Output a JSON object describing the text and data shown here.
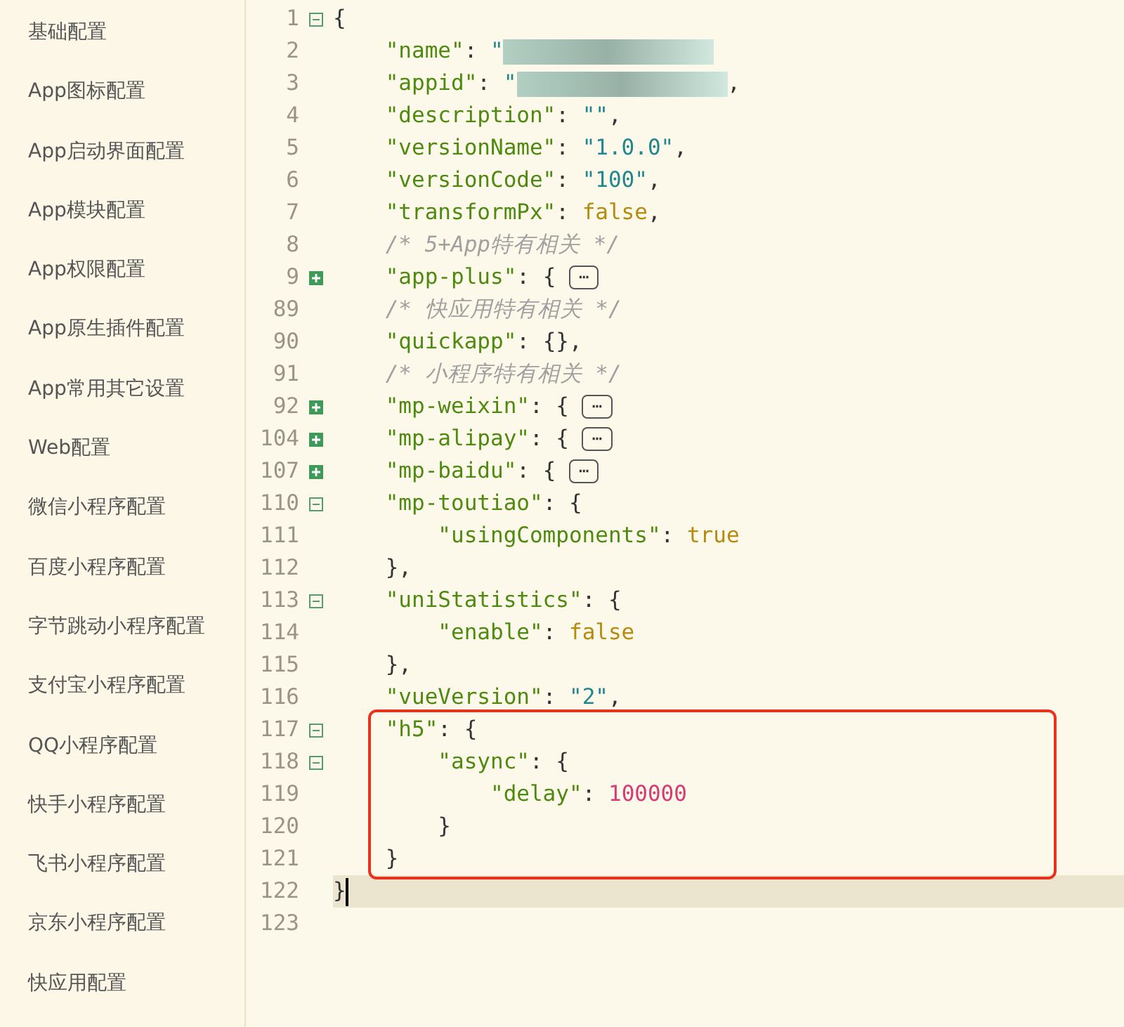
{
  "sidebar": {
    "items": [
      {
        "label": "基础配置"
      },
      {
        "label": "App图标配置"
      },
      {
        "label": "App启动界面配置"
      },
      {
        "label": "App模块配置"
      },
      {
        "label": "App权限配置"
      },
      {
        "label": "App原生插件配置"
      },
      {
        "label": "App常用其它设置"
      },
      {
        "label": "Web配置"
      },
      {
        "label": "微信小程序配置"
      },
      {
        "label": "百度小程序配置"
      },
      {
        "label": "字节跳动小程序配置"
      },
      {
        "label": "支付宝小程序配置"
      },
      {
        "label": "QQ小程序配置"
      },
      {
        "label": "快手小程序配置"
      },
      {
        "label": "飞书小程序配置"
      },
      {
        "label": "京东小程序配置"
      },
      {
        "label": "快应用配置"
      }
    ]
  },
  "editor": {
    "lines": [
      {
        "number": "1",
        "expanded": true,
        "boxed": false,
        "current": false,
        "tokens": [
          {
            "kind": "punct",
            "text": "{"
          }
        ]
      },
      {
        "number": "2",
        "boxed": false,
        "current": false,
        "tokens": [
          {
            "kind": "key",
            "text": "    \"name\""
          },
          {
            "kind": "punct",
            "text": ": "
          },
          {
            "kind": "string",
            "text": "\""
          },
          {
            "kind": "blur"
          }
        ]
      },
      {
        "number": "3",
        "boxed": false,
        "current": false,
        "tokens": [
          {
            "kind": "key",
            "text": "    \"appid\""
          },
          {
            "kind": "punct",
            "text": ": "
          },
          {
            "kind": "string",
            "text": "\""
          },
          {
            "kind": "blur"
          },
          {
            "kind": "punct",
            "text": ","
          }
        ]
      },
      {
        "number": "4",
        "boxed": false,
        "current": false,
        "tokens": [
          {
            "kind": "key",
            "text": "    \"description\""
          },
          {
            "kind": "punct",
            "text": ": "
          },
          {
            "kind": "string",
            "text": "\"\""
          },
          {
            "kind": "punct",
            "text": ","
          }
        ]
      },
      {
        "number": "5",
        "boxed": false,
        "current": false,
        "tokens": [
          {
            "kind": "key",
            "text": "    \"versionName\""
          },
          {
            "kind": "punct",
            "text": ": "
          },
          {
            "kind": "string",
            "text": "\"1.0.0\""
          },
          {
            "kind": "punct",
            "text": ","
          }
        ]
      },
      {
        "number": "6",
        "boxed": false,
        "current": false,
        "tokens": [
          {
            "kind": "key",
            "text": "    \"versionCode\""
          },
          {
            "kind": "punct",
            "text": ": "
          },
          {
            "kind": "string",
            "text": "\"100\""
          },
          {
            "kind": "punct",
            "text": ","
          }
        ]
      },
      {
        "number": "7",
        "boxed": false,
        "current": false,
        "tokens": [
          {
            "kind": "key",
            "text": "    \"transformPx\""
          },
          {
            "kind": "punct",
            "text": ": "
          },
          {
            "kind": "bool",
            "text": "false"
          },
          {
            "kind": "punct",
            "text": ","
          }
        ]
      },
      {
        "number": "8",
        "boxed": false,
        "current": false,
        "tokens": [
          {
            "kind": "comment",
            "text": "    /* 5+App特有相关 */"
          }
        ]
      },
      {
        "number": "9",
        "expanded": false,
        "boxed": false,
        "current": false,
        "tokens": [
          {
            "kind": "key",
            "text": "    \"app-plus\""
          },
          {
            "kind": "punct",
            "text": ": { "
          },
          {
            "kind": "collapsed",
            "text": "⋯"
          }
        ]
      },
      {
        "number": "89",
        "boxed": false,
        "current": false,
        "tokens": [
          {
            "kind": "comment",
            "text": "    /* 快应用特有相关 */"
          }
        ]
      },
      {
        "number": "90",
        "boxed": false,
        "current": false,
        "tokens": [
          {
            "kind": "key",
            "text": "    \"quickapp\""
          },
          {
            "kind": "punct",
            "text": ": {},"
          }
        ]
      },
      {
        "number": "91",
        "boxed": false,
        "current": false,
        "tokens": [
          {
            "kind": "comment",
            "text": "    /* 小程序特有相关 */"
          }
        ]
      },
      {
        "number": "92",
        "expanded": false,
        "boxed": false,
        "current": false,
        "tokens": [
          {
            "kind": "key",
            "text": "    \"mp-weixin\""
          },
          {
            "kind": "punct",
            "text": ": { "
          },
          {
            "kind": "collapsed",
            "text": "⋯"
          }
        ]
      },
      {
        "number": "104",
        "expanded": false,
        "boxed": false,
        "current": false,
        "tokens": [
          {
            "kind": "key",
            "text": "    \"mp-alipay\""
          },
          {
            "kind": "punct",
            "text": ": { "
          },
          {
            "kind": "collapsed",
            "text": "⋯"
          }
        ]
      },
      {
        "number": "107",
        "expanded": false,
        "boxed": false,
        "current": false,
        "tokens": [
          {
            "kind": "key",
            "text": "    \"mp-baidu\""
          },
          {
            "kind": "punct",
            "text": ": { "
          },
          {
            "kind": "collapsed",
            "text": "⋯"
          }
        ]
      },
      {
        "number": "110",
        "expanded": true,
        "boxed": false,
        "current": false,
        "tokens": [
          {
            "kind": "key",
            "text": "    \"mp-toutiao\""
          },
          {
            "kind": "punct",
            "text": ": {"
          }
        ]
      },
      {
        "number": "111",
        "boxed": false,
        "current": false,
        "tokens": [
          {
            "kind": "key",
            "text": "        \"usingComponents\""
          },
          {
            "kind": "punct",
            "text": ": "
          },
          {
            "kind": "bool",
            "text": "true"
          }
        ]
      },
      {
        "number": "112",
        "boxed": false,
        "current": false,
        "tokens": [
          {
            "kind": "punct",
            "text": "    },"
          }
        ]
      },
      {
        "number": "113",
        "expanded": true,
        "boxed": false,
        "current": false,
        "tokens": [
          {
            "kind": "key",
            "text": "    \"uniStatistics\""
          },
          {
            "kind": "punct",
            "text": ": {"
          }
        ]
      },
      {
        "number": "114",
        "boxed": false,
        "current": false,
        "tokens": [
          {
            "kind": "key",
            "text": "        \"enable\""
          },
          {
            "kind": "punct",
            "text": ": "
          },
          {
            "kind": "bool",
            "text": "false"
          }
        ]
      },
      {
        "number": "115",
        "boxed": false,
        "current": false,
        "tokens": [
          {
            "kind": "punct",
            "text": "    },"
          }
        ]
      },
      {
        "number": "116",
        "boxed": false,
        "current": false,
        "tokens": [
          {
            "kind": "key",
            "text": "    \"vueVersion\""
          },
          {
            "kind": "punct",
            "text": ": "
          },
          {
            "kind": "string",
            "text": "\"2\""
          },
          {
            "kind": "punct",
            "text": ","
          }
        ]
      },
      {
        "number": "117",
        "expanded": true,
        "boxed": true,
        "current": false,
        "tokens": [
          {
            "kind": "key",
            "text": "    \"h5\""
          },
          {
            "kind": "punct",
            "text": ": {"
          }
        ]
      },
      {
        "number": "118",
        "expanded": true,
        "boxed": true,
        "current": false,
        "tokens": [
          {
            "kind": "key",
            "text": "        \"async\""
          },
          {
            "kind": "punct",
            "text": ": {"
          }
        ]
      },
      {
        "number": "119",
        "boxed": true,
        "current": false,
        "tokens": [
          {
            "kind": "key",
            "text": "            \"delay\""
          },
          {
            "kind": "punct",
            "text": ": "
          },
          {
            "kind": "number",
            "text": "100000"
          }
        ]
      },
      {
        "number": "120",
        "boxed": true,
        "current": false,
        "tokens": [
          {
            "kind": "punct",
            "text": "        }"
          }
        ]
      },
      {
        "number": "121",
        "boxed": true,
        "current": false,
        "tokens": [
          {
            "kind": "punct",
            "text": "    }"
          }
        ]
      },
      {
        "number": "122",
        "boxed": false,
        "current": true,
        "tokens": [
          {
            "kind": "punct",
            "text": "}"
          }
        ]
      },
      {
        "number": "123",
        "boxed": false,
        "current": false
      }
    ]
  }
}
